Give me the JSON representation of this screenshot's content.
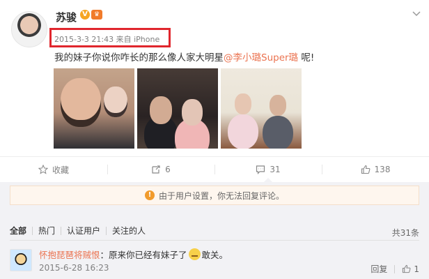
{
  "post": {
    "username": "苏骏",
    "badge_v": "V",
    "badge_crown": "♛",
    "meta": "2015-3-3 21:43 来自 iPhone",
    "text_before": "我的妹子你说你咋长的那么像人家大明星",
    "mention": "@李小璐Super璐",
    "text_after": " 呢!"
  },
  "actions": {
    "favorite": "收藏",
    "repost": "6",
    "comment": "31",
    "like": "138"
  },
  "comments": {
    "notice": "由于用户设置，你无法回复评论。",
    "filters": [
      "全部",
      "热门",
      "认证用户",
      "关注的人"
    ],
    "total": "共31条",
    "item": {
      "user": "怀抱琵琶将贼恨",
      "text_before": "：原来你已经有妹子了",
      "text_after": "敢关。",
      "time": "2015-6-28 16:23",
      "reply": "回复",
      "like_count": "1"
    }
  },
  "colors": {
    "highlight": "#e0262d",
    "link": "#eb7350",
    "notice_icon": "#f19b2c"
  }
}
